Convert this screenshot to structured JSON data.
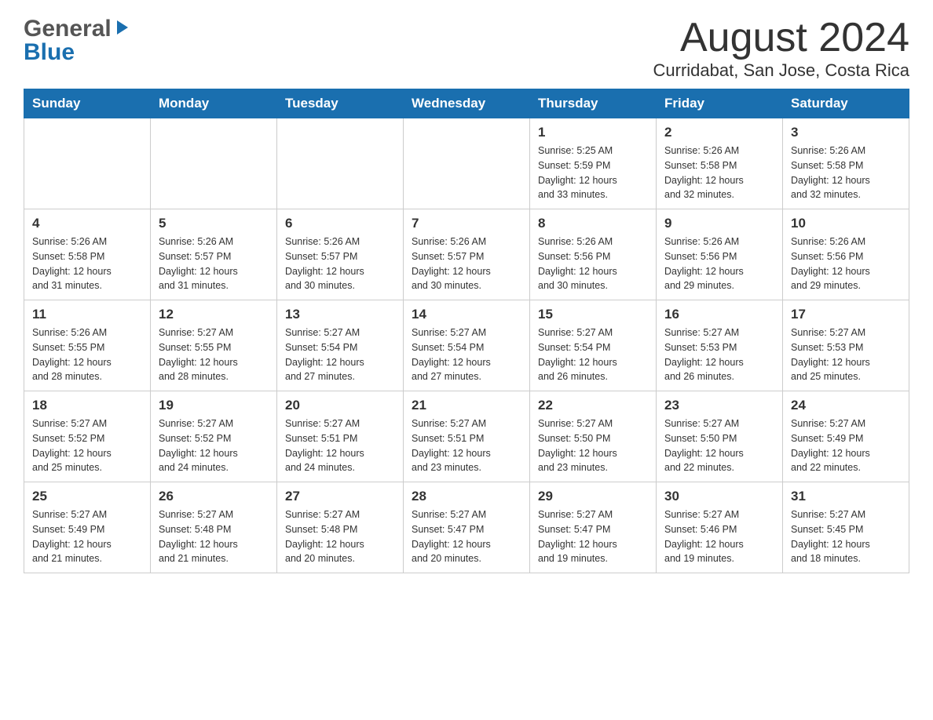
{
  "header": {
    "logo_general": "General",
    "logo_blue": "Blue",
    "month_title": "August 2024",
    "location": "Curridabat, San Jose, Costa Rica"
  },
  "weekdays": [
    "Sunday",
    "Monday",
    "Tuesday",
    "Wednesday",
    "Thursday",
    "Friday",
    "Saturday"
  ],
  "weeks": [
    {
      "days": [
        {
          "num": "",
          "info": ""
        },
        {
          "num": "",
          "info": ""
        },
        {
          "num": "",
          "info": ""
        },
        {
          "num": "",
          "info": ""
        },
        {
          "num": "1",
          "info": "Sunrise: 5:25 AM\nSunset: 5:59 PM\nDaylight: 12 hours\nand 33 minutes."
        },
        {
          "num": "2",
          "info": "Sunrise: 5:26 AM\nSunset: 5:58 PM\nDaylight: 12 hours\nand 32 minutes."
        },
        {
          "num": "3",
          "info": "Sunrise: 5:26 AM\nSunset: 5:58 PM\nDaylight: 12 hours\nand 32 minutes."
        }
      ]
    },
    {
      "days": [
        {
          "num": "4",
          "info": "Sunrise: 5:26 AM\nSunset: 5:58 PM\nDaylight: 12 hours\nand 31 minutes."
        },
        {
          "num": "5",
          "info": "Sunrise: 5:26 AM\nSunset: 5:57 PM\nDaylight: 12 hours\nand 31 minutes."
        },
        {
          "num": "6",
          "info": "Sunrise: 5:26 AM\nSunset: 5:57 PM\nDaylight: 12 hours\nand 30 minutes."
        },
        {
          "num": "7",
          "info": "Sunrise: 5:26 AM\nSunset: 5:57 PM\nDaylight: 12 hours\nand 30 minutes."
        },
        {
          "num": "8",
          "info": "Sunrise: 5:26 AM\nSunset: 5:56 PM\nDaylight: 12 hours\nand 30 minutes."
        },
        {
          "num": "9",
          "info": "Sunrise: 5:26 AM\nSunset: 5:56 PM\nDaylight: 12 hours\nand 29 minutes."
        },
        {
          "num": "10",
          "info": "Sunrise: 5:26 AM\nSunset: 5:56 PM\nDaylight: 12 hours\nand 29 minutes."
        }
      ]
    },
    {
      "days": [
        {
          "num": "11",
          "info": "Sunrise: 5:26 AM\nSunset: 5:55 PM\nDaylight: 12 hours\nand 28 minutes."
        },
        {
          "num": "12",
          "info": "Sunrise: 5:27 AM\nSunset: 5:55 PM\nDaylight: 12 hours\nand 28 minutes."
        },
        {
          "num": "13",
          "info": "Sunrise: 5:27 AM\nSunset: 5:54 PM\nDaylight: 12 hours\nand 27 minutes."
        },
        {
          "num": "14",
          "info": "Sunrise: 5:27 AM\nSunset: 5:54 PM\nDaylight: 12 hours\nand 27 minutes."
        },
        {
          "num": "15",
          "info": "Sunrise: 5:27 AM\nSunset: 5:54 PM\nDaylight: 12 hours\nand 26 minutes."
        },
        {
          "num": "16",
          "info": "Sunrise: 5:27 AM\nSunset: 5:53 PM\nDaylight: 12 hours\nand 26 minutes."
        },
        {
          "num": "17",
          "info": "Sunrise: 5:27 AM\nSunset: 5:53 PM\nDaylight: 12 hours\nand 25 minutes."
        }
      ]
    },
    {
      "days": [
        {
          "num": "18",
          "info": "Sunrise: 5:27 AM\nSunset: 5:52 PM\nDaylight: 12 hours\nand 25 minutes."
        },
        {
          "num": "19",
          "info": "Sunrise: 5:27 AM\nSunset: 5:52 PM\nDaylight: 12 hours\nand 24 minutes."
        },
        {
          "num": "20",
          "info": "Sunrise: 5:27 AM\nSunset: 5:51 PM\nDaylight: 12 hours\nand 24 minutes."
        },
        {
          "num": "21",
          "info": "Sunrise: 5:27 AM\nSunset: 5:51 PM\nDaylight: 12 hours\nand 23 minutes."
        },
        {
          "num": "22",
          "info": "Sunrise: 5:27 AM\nSunset: 5:50 PM\nDaylight: 12 hours\nand 23 minutes."
        },
        {
          "num": "23",
          "info": "Sunrise: 5:27 AM\nSunset: 5:50 PM\nDaylight: 12 hours\nand 22 minutes."
        },
        {
          "num": "24",
          "info": "Sunrise: 5:27 AM\nSunset: 5:49 PM\nDaylight: 12 hours\nand 22 minutes."
        }
      ]
    },
    {
      "days": [
        {
          "num": "25",
          "info": "Sunrise: 5:27 AM\nSunset: 5:49 PM\nDaylight: 12 hours\nand 21 minutes."
        },
        {
          "num": "26",
          "info": "Sunrise: 5:27 AM\nSunset: 5:48 PM\nDaylight: 12 hours\nand 21 minutes."
        },
        {
          "num": "27",
          "info": "Sunrise: 5:27 AM\nSunset: 5:48 PM\nDaylight: 12 hours\nand 20 minutes."
        },
        {
          "num": "28",
          "info": "Sunrise: 5:27 AM\nSunset: 5:47 PM\nDaylight: 12 hours\nand 20 minutes."
        },
        {
          "num": "29",
          "info": "Sunrise: 5:27 AM\nSunset: 5:47 PM\nDaylight: 12 hours\nand 19 minutes."
        },
        {
          "num": "30",
          "info": "Sunrise: 5:27 AM\nSunset: 5:46 PM\nDaylight: 12 hours\nand 19 minutes."
        },
        {
          "num": "31",
          "info": "Sunrise: 5:27 AM\nSunset: 5:45 PM\nDaylight: 12 hours\nand 18 minutes."
        }
      ]
    }
  ]
}
